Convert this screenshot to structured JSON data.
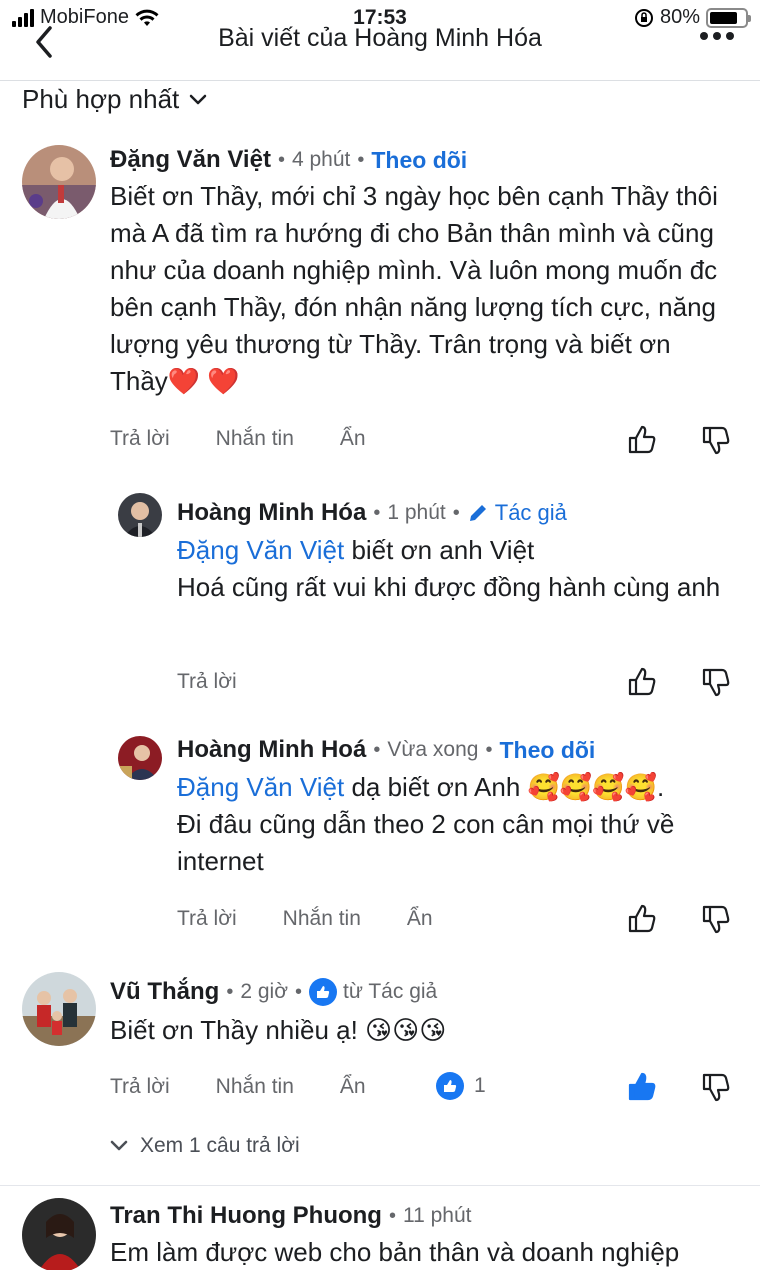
{
  "status_bar": {
    "carrier": "MobiFone",
    "time": "17:53",
    "battery": "80%",
    "battery_level": 0.8
  },
  "header": {
    "title": "Bài viết của Hoàng Minh Hóa"
  },
  "sort": {
    "label": "Phù hợp nhất"
  },
  "comments": [
    {
      "author": "Đặng Văn Việt",
      "time": "4 phút",
      "tag": "Theo dõi",
      "text": "Biết ơn Thầy, mới chỉ 3 ngày học bên cạnh Thầy thôi mà A đã tìm ra hướng đi cho Bản thân mình và cũng như của doanh nghiệp mình. Và luôn mong muốn đc bên cạnh Thầy, đón nhận năng lượng tích cực, năng lượng yêu thương từ Thầy. Trân trọng và biết ơn Thầy❤️ ❤️",
      "actions": [
        "Trả lời",
        "Nhắn tin",
        "Ẩn"
      ]
    },
    {
      "author": "Hoàng Minh Hóa",
      "time": "1 phút",
      "tag": "Tác giả",
      "mention": "Đặng Văn Việt",
      "text": "biết ơn anh Việt\nHoá cũng rất vui khi được đồng hành cùng anh",
      "actions": [
        "Trả lời"
      ]
    },
    {
      "author": "Hoàng Minh Hoá",
      "time": "Vừa xong",
      "tag": "Theo dõi",
      "mention": "Đặng Văn Việt",
      "text": "dạ biết ơn Anh 🥰🥰🥰🥰.\nĐi đâu cũng dẫn theo 2 con cân mọi thứ về internet",
      "actions": [
        "Trả lời",
        "Nhắn tin",
        "Ẩn"
      ]
    },
    {
      "author": "Vũ Thắng",
      "time": "2 giờ",
      "tag": "từ Tác giả",
      "text": "Biết ơn Thầy nhiều ạ! 😘😘😘",
      "actions": [
        "Trả lời",
        "Nhắn tin",
        "Ẩn"
      ],
      "like_count": "1",
      "view_replies": "Xem 1 câu trả lời"
    },
    {
      "author": "Tran Thi Huong Phuong",
      "time": "11 phút",
      "text": "Em làm được web cho bản thân và doanh nghiệp"
    }
  ],
  "colors": {
    "link": "#1a6ed8",
    "like_active": "#1877f2",
    "muted": "#65676b"
  },
  "icons": [
    "back-chevron-icon",
    "more-dots-icon",
    "chevron-down-icon",
    "thumbs-up-icon",
    "thumbs-down-icon",
    "pencil-icon",
    "like-badge-icon"
  ]
}
